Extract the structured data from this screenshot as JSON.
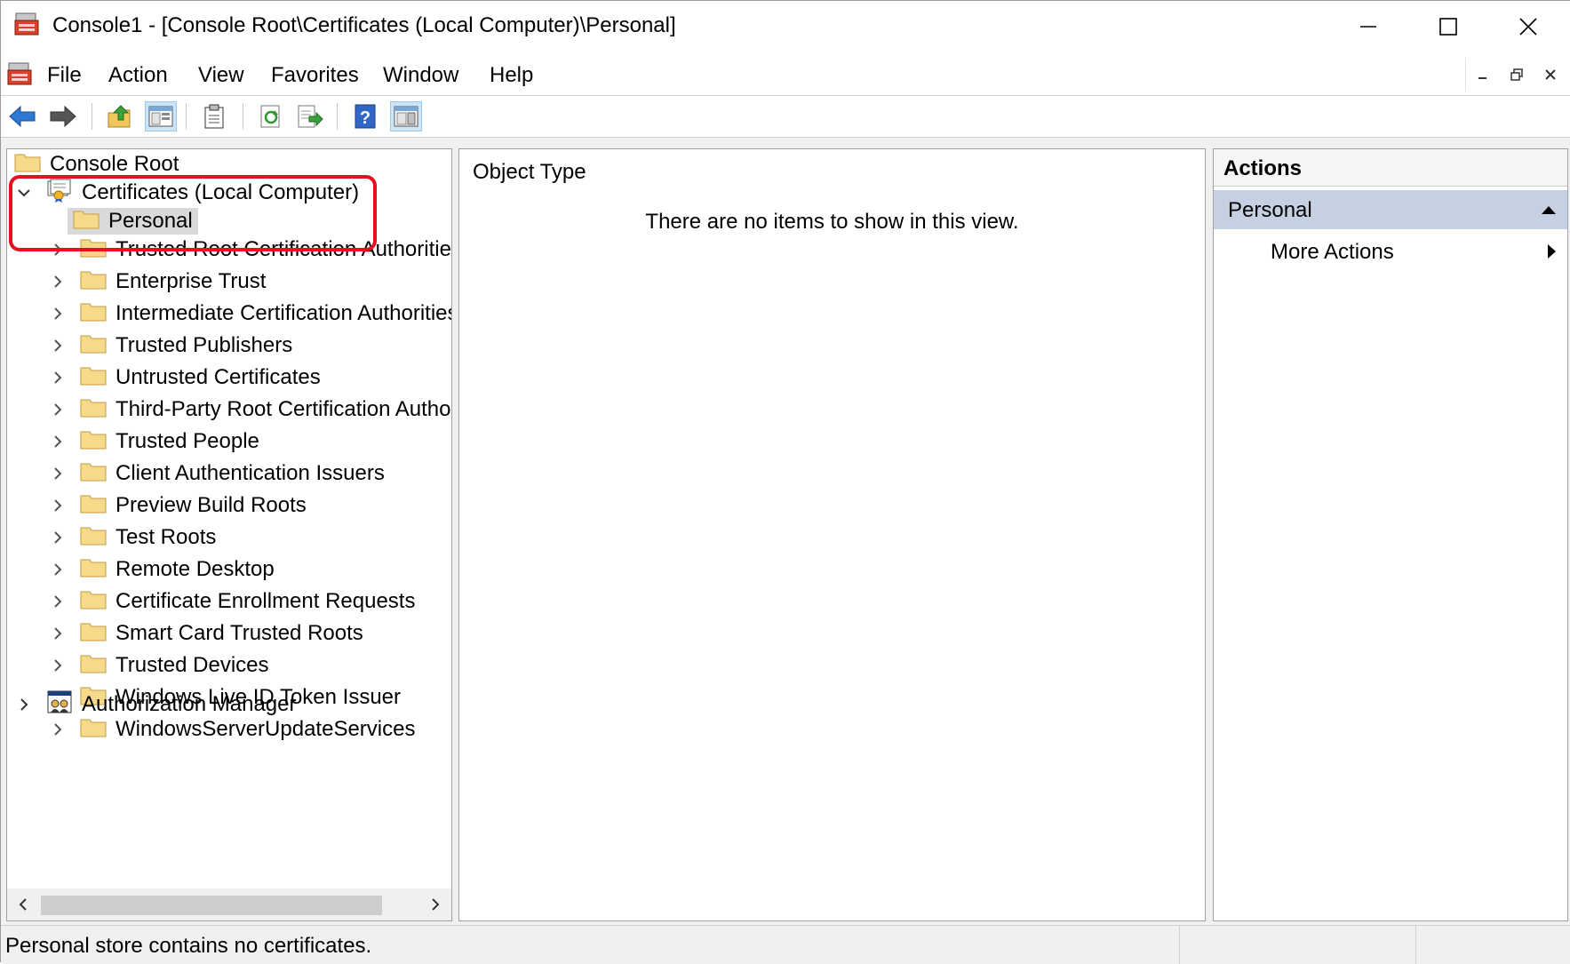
{
  "window": {
    "title": "Console1 - [Console Root\\Certificates (Local Computer)\\Personal]"
  },
  "menu": {
    "items": [
      "File",
      "Action",
      "View",
      "Favorites",
      "Window",
      "Help"
    ]
  },
  "toolbar": {
    "buttons": [
      "back-icon",
      "forward-icon",
      "up-folder-icon",
      "show-hide-tree-icon",
      "clipboard-icon",
      "refresh-icon",
      "export-list-icon",
      "help-icon",
      "show-hide-action-pane-icon"
    ]
  },
  "tree": {
    "root": "Console Root",
    "certificates": "Certificates (Local Computer)",
    "selected": "Personal",
    "stores": [
      "Trusted Root Certification Authorities",
      "Enterprise Trust",
      "Intermediate Certification Authorities",
      "Trusted Publishers",
      "Untrusted Certificates",
      "Third-Party Root Certification Authorities",
      "Trusted People",
      "Client Authentication Issuers",
      "Preview Build Roots",
      "Test Roots",
      "Remote Desktop",
      "Certificate Enrollment Requests",
      "Smart Card Trusted Roots",
      "Trusted Devices",
      "Windows Live ID Token Issuer",
      "WindowsServerUpdateServices"
    ],
    "authorization": "Authorization Manager"
  },
  "content": {
    "column_header": "Object Type",
    "empty_message": "There are no items to show in this view."
  },
  "actions": {
    "title": "Actions",
    "section": "Personal",
    "more": "More Actions"
  },
  "status": {
    "text": "Personal store contains no certificates."
  },
  "colors": {
    "highlight": "#e8101e",
    "section_bg": "#c5d1e2",
    "selection_bg": "#d9d9d9"
  }
}
